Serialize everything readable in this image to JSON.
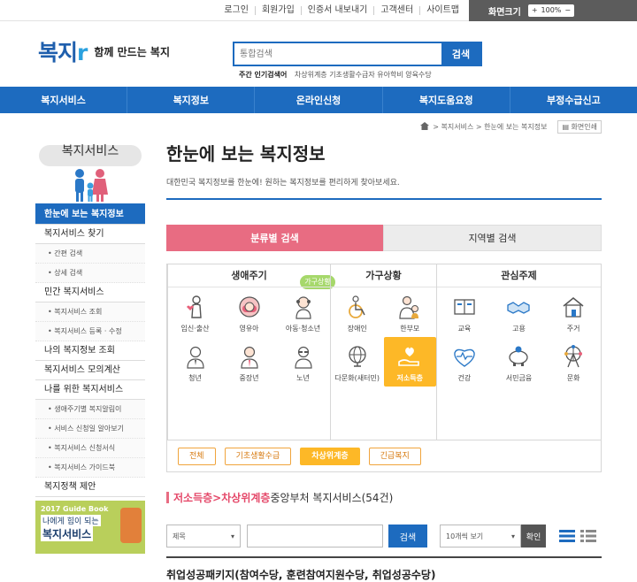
{
  "util_links": [
    "로그인",
    "회원가입",
    "인증서 내보내기",
    "고객센터",
    "사이트맵"
  ],
  "zoom": {
    "label": "화면크기",
    "plus": "+",
    "value": "100%",
    "minus": "−"
  },
  "logo": {
    "text_a": "복지",
    "text_b": "r",
    "slogan": "함께 만드는 복지"
  },
  "search": {
    "placeholder": "통합검색",
    "button": "검색"
  },
  "popular": {
    "label": "주간 인기검색어",
    "items": "차상위계층   기초생활수급자   유아학비   양육수당"
  },
  "gnb": [
    "복지서비스",
    "복지정보",
    "온라인신청",
    "복지도움요청",
    "부정수급신고"
  ],
  "breadcrumb": {
    "path": "> 복지서비스 > 한눈에 보는 복지정보",
    "print": "화면인쇄"
  },
  "lnb": {
    "title": "복지서비스",
    "items": [
      {
        "label": "한눈에 보는 복지정보",
        "type": "m1",
        "on": true
      },
      {
        "label": "복지서비스 찾기",
        "type": "m1"
      },
      {
        "label": "간편 검색",
        "type": "m2"
      },
      {
        "label": "상세 검색",
        "type": "m2"
      },
      {
        "label": "민간 복지서비스",
        "type": "m1"
      },
      {
        "label": "복지서비스 조회",
        "type": "m2"
      },
      {
        "label": "복지서비스 등록 · 수정",
        "type": "m2"
      },
      {
        "label": "나의 복지정보 조회",
        "type": "m1"
      },
      {
        "label": "복지서비스 모의계산",
        "type": "m1"
      },
      {
        "label": "나를 위한 복지서비스",
        "type": "m1"
      },
      {
        "label": "생애주기별 복지알림이",
        "type": "m2"
      },
      {
        "label": "서비스 신청일 알아보기",
        "type": "m2"
      },
      {
        "label": "복지서비스 신청서식",
        "type": "m2"
      },
      {
        "label": "복지서비스 가이드북",
        "type": "m2"
      },
      {
        "label": "복지정책 제안",
        "type": "m1"
      }
    ],
    "banner": {
      "line1": "2017 Guide Book",
      "line2": "나에게 힘이 되는",
      "line3": "복지서비스"
    }
  },
  "main": {
    "title": "한눈에 보는 복지정보",
    "desc": "대한민국 복지정보를 한눈에! 원하는 복지정보를 편리하게 찾아보세요.",
    "tabs": [
      "분류별 검색",
      "지역별 검색"
    ],
    "badge": "가구상황",
    "columns": [
      {
        "head": "생애주기",
        "items": [
          {
            "label": "임신·출산",
            "icon": "pregnant-icon"
          },
          {
            "label": "영유아",
            "icon": "baby-icon"
          },
          {
            "label": "아동·청소년",
            "icon": "child-icon"
          },
          {
            "label": "청년",
            "icon": "young-adult-icon"
          },
          {
            "label": "중장년",
            "icon": "middle-aged-icon"
          },
          {
            "label": "노년",
            "icon": "elderly-icon"
          }
        ]
      },
      {
        "head": "가구상황",
        "items": [
          {
            "label": "장애인",
            "icon": "wheelchair-icon"
          },
          {
            "label": "한부모",
            "icon": "single-parent-icon"
          },
          {
            "label": "다문화(새터민)",
            "icon": "globe-icon"
          },
          {
            "label": "저소득층",
            "icon": "hand-heart-icon",
            "selected": true
          }
        ]
      },
      {
        "head": "관심주제",
        "items": [
          {
            "label": "교육",
            "icon": "book-icon"
          },
          {
            "label": "고용",
            "icon": "handshake-icon"
          },
          {
            "label": "주거",
            "icon": "house-icon"
          },
          {
            "label": "건강",
            "icon": "heart-pulse-icon"
          },
          {
            "label": "서민금융",
            "icon": "piggy-bank-icon"
          },
          {
            "label": "문화",
            "icon": "ferris-wheel-icon"
          }
        ]
      }
    ],
    "chips": [
      {
        "label": "전체"
      },
      {
        "label": "기초생활수급"
      },
      {
        "label": "차상위계층",
        "on": true
      },
      {
        "label": "긴급복지"
      }
    ],
    "result": {
      "a": "저소득층",
      "sep1": " > ",
      "b": "차상위계층",
      "rest": " 중앙부처 복지서비스(54건)"
    },
    "filter": {
      "select1": "제목",
      "button": "검색",
      "select2": "10개씩 보기",
      "ok": "확인"
    },
    "first_item": "취업성공패키지(참여수당, 훈련참여지원수당, 취업성공수당)"
  },
  "colors": {
    "primary": "#1d6bbf",
    "pink": "#e86c82",
    "orange": "#fdb827"
  }
}
